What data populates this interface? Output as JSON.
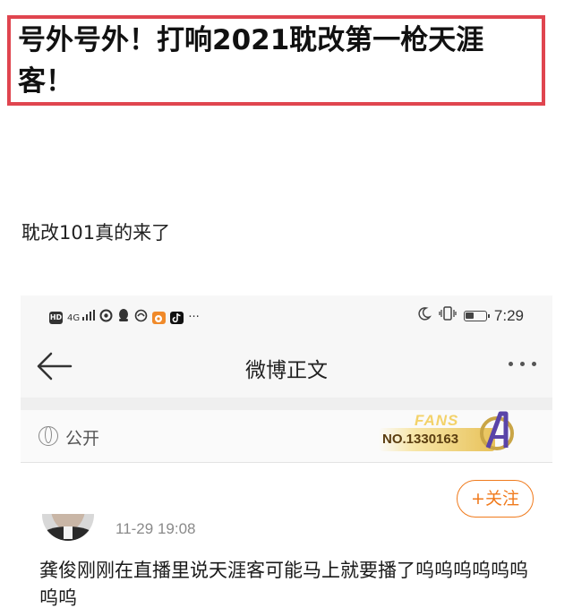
{
  "article": {
    "headline": "号外号外！打响2021耽改第一枪天涯客！",
    "body_line": "耽改101真的来了"
  },
  "statusbar": {
    "icons_left": [
      "hd-icon",
      "signal-icon",
      "netease-icon",
      "qq-icon",
      "uc-browser-icon",
      "weibo-lite-icon",
      "tiktok-icon",
      "more-dots-icon"
    ],
    "net": "4G",
    "hd": "HD",
    "overflow": "···",
    "time": "7:29",
    "battery_level": 0.45
  },
  "navbar": {
    "title": "微博正文"
  },
  "meta": {
    "visibility": "公开",
    "fans_label": "FANS",
    "fans_number": "NO.1330163"
  },
  "post": {
    "follow_label": "+关注",
    "time": "11-29 19:08",
    "text": "龚俊刚刚在直播里说天涯客可能马上就要播了呜呜呜呜呜呜呜呜"
  },
  "colors": {
    "headline_border": "#e0454f",
    "follow_accent": "#f07a1c"
  }
}
